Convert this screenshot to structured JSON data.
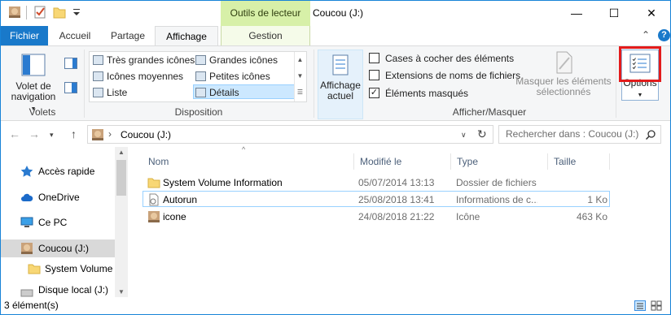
{
  "window": {
    "context_tab_group": "Outils de lecteur",
    "title": "Coucou (J:)",
    "caption": {
      "minimize": "—",
      "maximize": "☐",
      "close": "✕"
    }
  },
  "tabs": {
    "file": "Fichier",
    "home": "Accueil",
    "share": "Partage",
    "view": "Affichage",
    "manage": "Gestion"
  },
  "ribbon": {
    "panes": {
      "nav_pane_label": "Volet de navigation",
      "group_label": "Volets"
    },
    "layout": {
      "group_label": "Disposition",
      "items": [
        "Très grandes icônes",
        "Grandes icônes",
        "Icônes moyennes",
        "Petites icônes",
        "Liste",
        "Détails"
      ],
      "selected": "Détails"
    },
    "show_hide": {
      "current_view_label": "Affichage actuel",
      "checkboxes": [
        {
          "label": "Cases à cocher des éléments",
          "checked": false
        },
        {
          "label": "Extensions de noms de fichiers",
          "checked": false
        },
        {
          "label": "Éléments masqués",
          "checked": true
        }
      ],
      "hide_selected_label": "Masquer les éléments sélectionnés",
      "group_label": "Afficher/Masquer"
    },
    "options_label": "Options"
  },
  "address": {
    "path": "Coucou (J:)",
    "search_placeholder": "Rechercher dans : Coucou (J:)"
  },
  "nav_pane": {
    "items": [
      {
        "label": "Accès rapide",
        "icon": "star-icon"
      },
      {
        "label": "OneDrive",
        "icon": "cloud-icon"
      },
      {
        "label": "Ce PC",
        "icon": "computer-icon"
      },
      {
        "label": "Coucou (J:)",
        "icon": "drive-icon"
      },
      {
        "label": "System Volume I",
        "icon": "folder-icon"
      },
      {
        "label": "Disque local (J:)",
        "icon": "drive-icon"
      }
    ]
  },
  "file_list": {
    "columns": {
      "name": "Nom",
      "modified": "Modifié le",
      "type": "Type",
      "size": "Taille"
    },
    "rows": [
      {
        "name": "System Volume Information",
        "modified": "05/07/2014 13:13",
        "type": "Dossier de fichiers",
        "size": "",
        "icon": "folder-icon"
      },
      {
        "name": "Autorun",
        "modified": "25/08/2018 13:41",
        "type": "Informations de c...",
        "size": "1 Ko",
        "icon": "file-icon"
      },
      {
        "name": "icone",
        "modified": "24/08/2018 21:22",
        "type": "Icône",
        "size": "463 Ko",
        "icon": "image-icon"
      }
    ]
  },
  "status": {
    "count": "3 élément(s)"
  },
  "colors": {
    "accent": "#1979ca",
    "context_tab": "#d7f0a8",
    "highlight_box": "#e31b1b"
  }
}
